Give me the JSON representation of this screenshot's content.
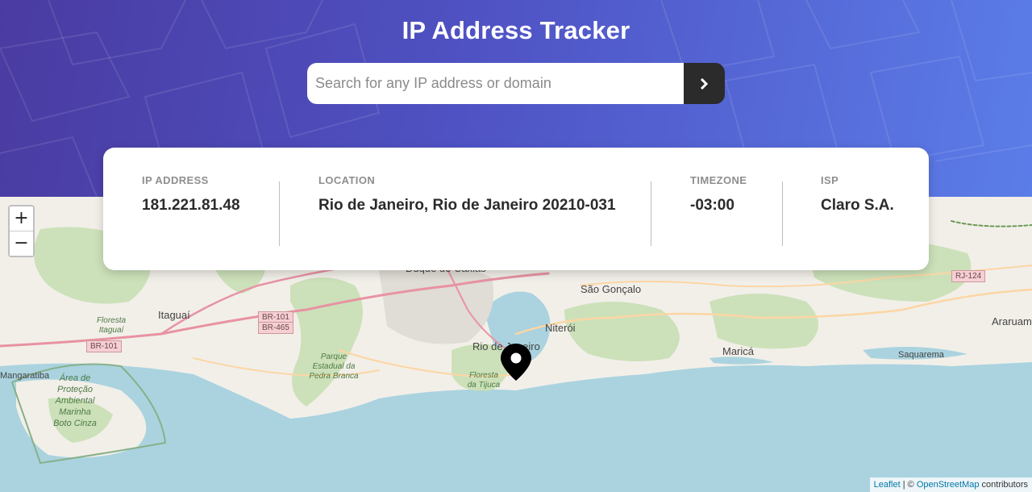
{
  "header": {
    "title": "IP Address Tracker",
    "search_placeholder": "Search for any IP address or domain",
    "search_value": ""
  },
  "info": {
    "ip_label": "IP ADDRESS",
    "ip_value": "181.221.81.48",
    "location_label": "LOCATION",
    "location_value": "Rio de Janeiro, Rio de Janeiro 20210-031",
    "timezone_label": "TIMEZONE",
    "timezone_value": "-03:00",
    "isp_label": "ISP",
    "isp_value": "Claro S.A."
  },
  "map": {
    "zoom_in": "+",
    "zoom_out": "−",
    "attribution_leaflet": "Leaflet",
    "attribution_sep": " | © ",
    "attribution_osm": "OpenStreetMap",
    "attribution_contrib": " contributors",
    "labels": {
      "itaguai": "Itaguaí",
      "mangaratiba": "Mangaratiba",
      "duque": "Duque de Caxias",
      "sao_goncalo": "São Gonçalo",
      "niteroi": "Niterói",
      "rio": "Rio de Janeiro",
      "marica": "Maricá",
      "saquarema": "Saquarema",
      "araruama": "Araruam",
      "floresta_itaguai": "Floresta Itaguaí",
      "area_protecao": "Área de Proteção Ambiental Marinha Boto Cinza",
      "parque_estadual": "Parque Estadual da Pedra Branca",
      "floresta_tijuca": "Floresta da Tijuca"
    },
    "shields": {
      "br101_west": "BR-101",
      "br101": "BR-101",
      "br465": "BR-465",
      "rj124": "RJ-124"
    }
  },
  "colors": {
    "header_start": "#4a3ba1",
    "header_end": "#5b7de8",
    "button_dark": "#2b2b2b",
    "water": "#aad3df",
    "land": "#f2efe9"
  }
}
